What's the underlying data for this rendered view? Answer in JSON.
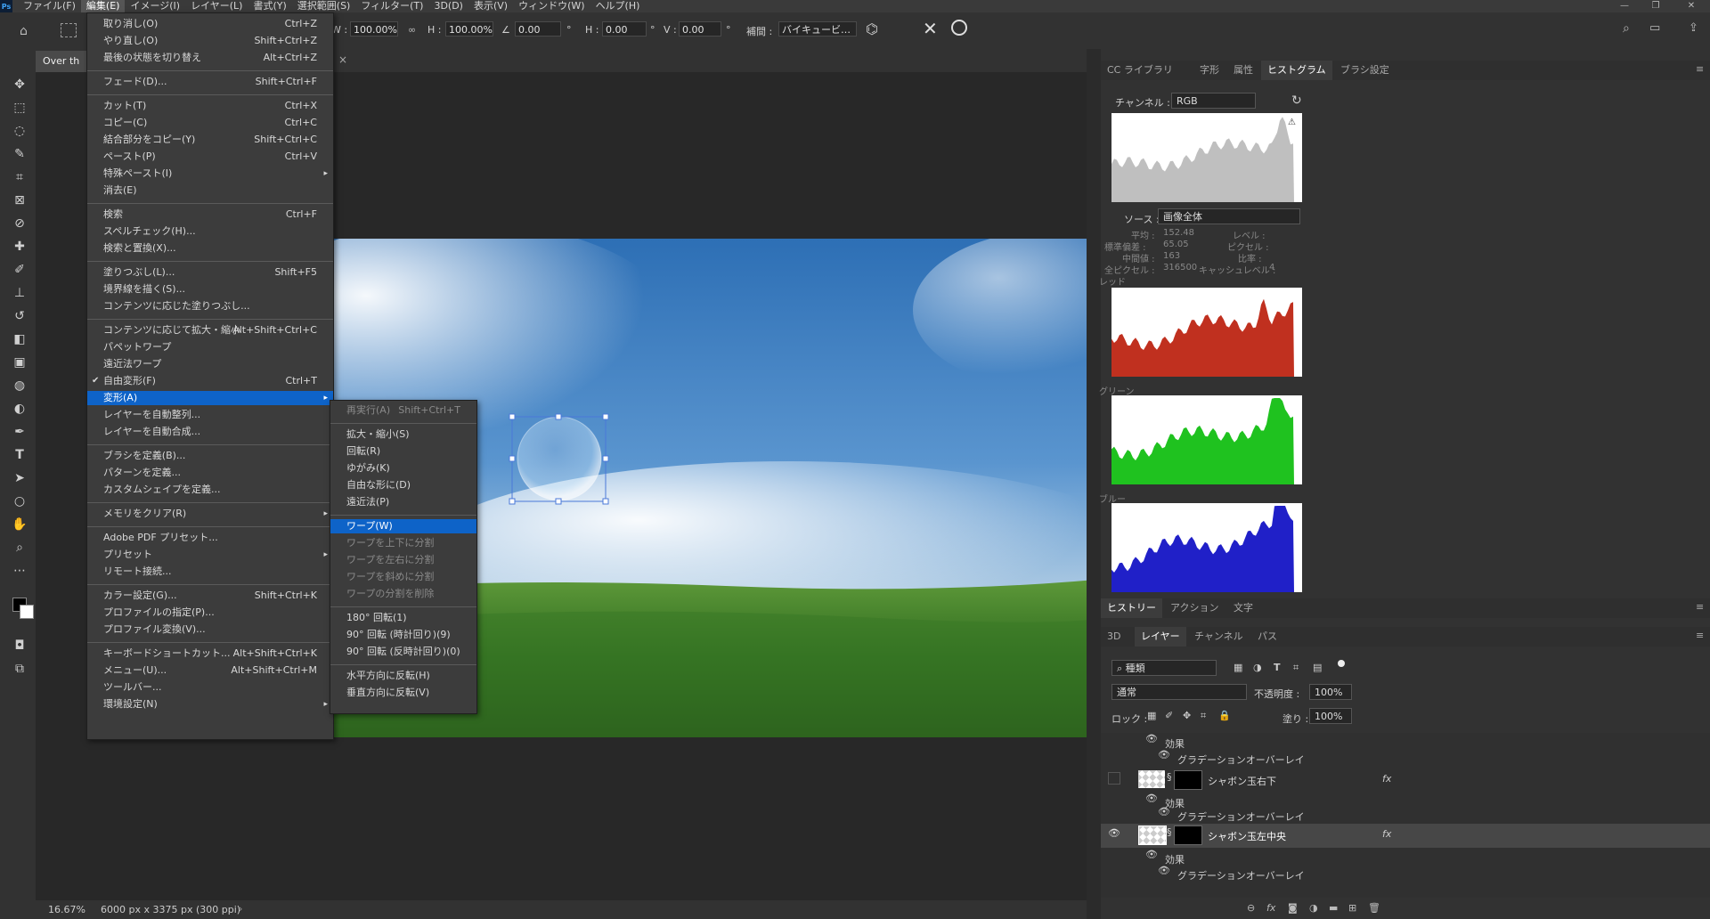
{
  "app": {
    "logo": "Ps"
  },
  "menubar": {
    "items": [
      "ファイル(F)",
      "編集(E)",
      "イメージ(I)",
      "レイヤー(L)",
      "書式(Y)",
      "選択範囲(S)",
      "フィルター(T)",
      "3D(D)",
      "表示(V)",
      "ウィンドウ(W)",
      "ヘルプ(H)"
    ],
    "active_index": 1
  },
  "options": {
    "w_label": "W :",
    "w_value": "100.00%",
    "h_label": "H :",
    "h_value": "100.00%",
    "angle_value": "0.00",
    "deg": "°",
    "hskew_label": "H :",
    "hskew_value": "0.00",
    "vskew_label": "V :",
    "vskew_value": "0.00",
    "interp_label": "補間 :",
    "interp_value": "バイキュービ…",
    "cancel_icon": "close-icon",
    "commit_icon": "circle-icon"
  },
  "document": {
    "tab_label": "Over th",
    "zoom": "16.67%",
    "info": "6000 px x 3375 px (300 ppi)"
  },
  "edit_menu": {
    "items": [
      {
        "label": "取り消し(O)",
        "shortcut": "Ctrl+Z"
      },
      {
        "label": "やり直し(O)",
        "shortcut": "Shift+Ctrl+Z"
      },
      {
        "label": "最後の状態を切り替え",
        "shortcut": "Alt+Ctrl+Z"
      },
      {
        "sep": true
      },
      {
        "label": "フェード(D)...",
        "shortcut": "Shift+Ctrl+F"
      },
      {
        "sep": true
      },
      {
        "label": "カット(T)",
        "shortcut": "Ctrl+X"
      },
      {
        "label": "コピー(C)",
        "shortcut": "Ctrl+C"
      },
      {
        "label": "結合部分をコピー(Y)",
        "shortcut": "Shift+Ctrl+C"
      },
      {
        "label": "ペースト(P)",
        "shortcut": "Ctrl+V"
      },
      {
        "label": "特殊ペースト(I)",
        "shortcut": "",
        "sub": true
      },
      {
        "label": "消去(E)",
        "shortcut": ""
      },
      {
        "sep": true
      },
      {
        "label": "検索",
        "shortcut": "Ctrl+F"
      },
      {
        "label": "スペルチェック(H)...",
        "shortcut": ""
      },
      {
        "label": "検索と置換(X)...",
        "shortcut": ""
      },
      {
        "sep": true
      },
      {
        "label": "塗りつぶし(L)...",
        "shortcut": "Shift+F5"
      },
      {
        "label": "境界線を描く(S)...",
        "shortcut": ""
      },
      {
        "label": "コンテンツに応じた塗りつぶし...",
        "shortcut": ""
      },
      {
        "sep": true
      },
      {
        "label": "コンテンツに応じて拡大・縮小",
        "shortcut": "Alt+Shift+Ctrl+C"
      },
      {
        "label": "パペットワープ",
        "shortcut": ""
      },
      {
        "label": "遠近法ワープ",
        "shortcut": ""
      },
      {
        "label": "自由変形(F)",
        "shortcut": "Ctrl+T",
        "check": true
      },
      {
        "label": "変形(A)",
        "shortcut": "",
        "sub": true,
        "hl": true
      },
      {
        "label": "レイヤーを自動整列...",
        "shortcut": ""
      },
      {
        "label": "レイヤーを自動合成...",
        "shortcut": ""
      },
      {
        "sep": true
      },
      {
        "label": "ブラシを定義(B)...",
        "shortcut": ""
      },
      {
        "label": "パターンを定義...",
        "shortcut": ""
      },
      {
        "label": "カスタムシェイプを定義...",
        "shortcut": ""
      },
      {
        "sep": true
      },
      {
        "label": "メモリをクリア(R)",
        "shortcut": "",
        "sub": true
      },
      {
        "sep": true
      },
      {
        "label": "Adobe PDF プリセット...",
        "shortcut": ""
      },
      {
        "label": "プリセット",
        "shortcut": "",
        "sub": true
      },
      {
        "label": "リモート接続...",
        "shortcut": ""
      },
      {
        "sep": true
      },
      {
        "label": "カラー設定(G)...",
        "shortcut": "Shift+Ctrl+K"
      },
      {
        "label": "プロファイルの指定(P)...",
        "shortcut": ""
      },
      {
        "label": "プロファイル変換(V)...",
        "shortcut": ""
      },
      {
        "sep": true
      },
      {
        "label": "キーボードショートカット...",
        "shortcut": "Alt+Shift+Ctrl+K"
      },
      {
        "label": "メニュー(U)...",
        "shortcut": "Alt+Shift+Ctrl+M"
      },
      {
        "label": "ツールバー...",
        "shortcut": ""
      },
      {
        "label": "環境設定(N)",
        "shortcut": "",
        "sub": true
      }
    ]
  },
  "transform_menu": {
    "items": [
      {
        "label": "再実行(A)",
        "shortcut": "Shift+Ctrl+T",
        "dis": true
      },
      {
        "sep": true
      },
      {
        "label": "拡大・縮小(S)"
      },
      {
        "label": "回転(R)"
      },
      {
        "label": "ゆがみ(K)"
      },
      {
        "label": "自由な形に(D)"
      },
      {
        "label": "遠近法(P)"
      },
      {
        "sep": true
      },
      {
        "label": "ワープ(W)",
        "hl": true
      },
      {
        "label": "ワープを上下に分割",
        "dis": true
      },
      {
        "label": "ワープを左右に分割",
        "dis": true
      },
      {
        "label": "ワープを斜めに分割",
        "dis": true
      },
      {
        "label": "ワープの分割を削除",
        "dis": true
      },
      {
        "sep": true
      },
      {
        "label": "180° 回転(1)"
      },
      {
        "label": "90° 回転 (時計回り)(9)"
      },
      {
        "label": "90° 回転 (反時計回り)(0)"
      },
      {
        "sep": true
      },
      {
        "label": "水平方向に反転(H)"
      },
      {
        "label": "垂直方向に反転(V)"
      }
    ]
  },
  "panels": {
    "top_tabs": [
      "CC ライブラリ",
      "字形",
      "属性",
      "ヒストグラム",
      "ブラシ設定"
    ],
    "top_active": 3,
    "channel_label": "チャンネル :",
    "channel_value": "RGB",
    "source_label": "ソース :",
    "source_value": "画像全体",
    "stats": {
      "mean_label": "平均 :",
      "mean": "152.48",
      "std_label": "標準偏差 :",
      "std": "65.05",
      "median_label": "中間値 :",
      "median": "163",
      "pixels_label": "全ピクセル :",
      "pixels": "316500",
      "level_label": "レベル :",
      "count_label": "ピクセル :",
      "percent_label": "比率 :",
      "cache_label": "キャッシュレベル :",
      "cache": "4"
    },
    "red_label": "レッド",
    "green_label": "グリーン",
    "blue_label": "ブルー",
    "colors": {
      "red": "#c0301f",
      "green": "#1fc21f",
      "blue": "#2020c8"
    },
    "mid_tabs": [
      "ヒストリー",
      "アクション",
      "文字"
    ],
    "layer_tabs": [
      "3D",
      "レイヤー",
      "チャンネル",
      "パス"
    ],
    "layer_active": 1,
    "kind_value": "種類",
    "blend_value": "通常",
    "opacity_label": "不透明度 :",
    "opacity_value": "100%",
    "lock_label": "ロック :",
    "fill_label": "塗り :",
    "fill_value": "100%",
    "layers": [
      {
        "effects_label": "効果",
        "effect": "グラデーションオーバーレイ"
      },
      {
        "name": "シャボン玉右下",
        "effects_label": "効果",
        "effect": "グラデーションオーバーレイ",
        "visible": false
      },
      {
        "name": "シャボン玉左中央",
        "effects_label": "効果",
        "effect": "グラデーションオーバーレイ",
        "visible": true,
        "selected": true
      }
    ]
  }
}
